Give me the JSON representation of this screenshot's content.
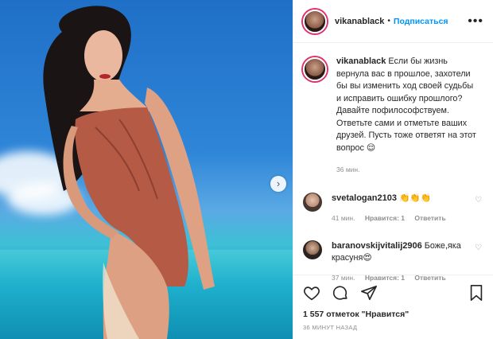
{
  "post": {
    "author": "vikanablack",
    "follow_label": "Подписаться",
    "dot": "•",
    "more_icon": "ellipsis-icon"
  },
  "caption": {
    "username": "vikanablack",
    "text": "Если бы жизнь вернула вас в прошлое, захотели бы вы изменить ход своей судьбы и исправить ошибку прошлого? Давайте пофилософствуем. Ответьте сами и отметьте ваших друзей. Пусть тоже ответят на этот вопрос 😌",
    "time": "36 мин."
  },
  "comments": [
    {
      "username": "svetalogan2103",
      "text": "👏👏👏",
      "time": "41 мин.",
      "likes": "Нравится: 1",
      "reply": "Ответить"
    },
    {
      "username": "baranovskijvitalij2906",
      "text": "Боже,яка красуня😍",
      "time": "37 мин.",
      "likes": "Нравится: 1",
      "reply": "Ответить"
    }
  ],
  "footer": {
    "likes_text": "1 557 отметок \"Нравится\"",
    "timestamp": "36 МИНУТ НАЗАД"
  },
  "colors": {
    "link": "#0095f6",
    "text": "#262626",
    "muted": "#8e8e8e"
  }
}
